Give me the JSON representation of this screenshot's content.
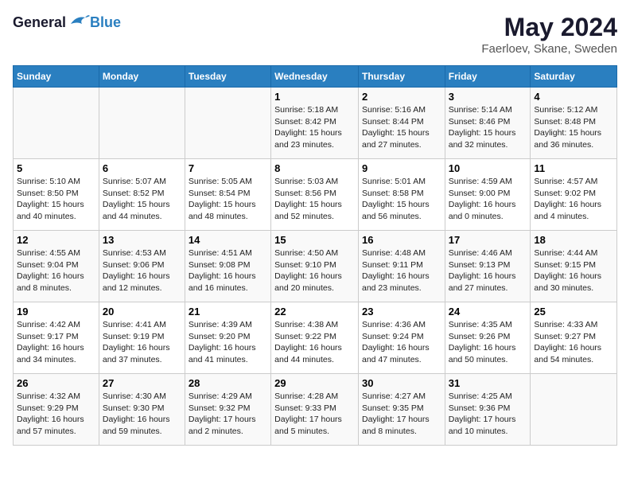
{
  "header": {
    "logo_text_general": "General",
    "logo_text_blue": "Blue",
    "month_title": "May 2024",
    "location": "Faerloev, Skane, Sweden"
  },
  "days_of_week": [
    "Sunday",
    "Monday",
    "Tuesday",
    "Wednesday",
    "Thursday",
    "Friday",
    "Saturday"
  ],
  "weeks": [
    {
      "cells": [
        {
          "day": "",
          "info": ""
        },
        {
          "day": "",
          "info": ""
        },
        {
          "day": "",
          "info": ""
        },
        {
          "day": "1",
          "info": "Sunrise: 5:18 AM\nSunset: 8:42 PM\nDaylight: 15 hours\nand 23 minutes."
        },
        {
          "day": "2",
          "info": "Sunrise: 5:16 AM\nSunset: 8:44 PM\nDaylight: 15 hours\nand 27 minutes."
        },
        {
          "day": "3",
          "info": "Sunrise: 5:14 AM\nSunset: 8:46 PM\nDaylight: 15 hours\nand 32 minutes."
        },
        {
          "day": "4",
          "info": "Sunrise: 5:12 AM\nSunset: 8:48 PM\nDaylight: 15 hours\nand 36 minutes."
        }
      ]
    },
    {
      "cells": [
        {
          "day": "5",
          "info": "Sunrise: 5:10 AM\nSunset: 8:50 PM\nDaylight: 15 hours\nand 40 minutes."
        },
        {
          "day": "6",
          "info": "Sunrise: 5:07 AM\nSunset: 8:52 PM\nDaylight: 15 hours\nand 44 minutes."
        },
        {
          "day": "7",
          "info": "Sunrise: 5:05 AM\nSunset: 8:54 PM\nDaylight: 15 hours\nand 48 minutes."
        },
        {
          "day": "8",
          "info": "Sunrise: 5:03 AM\nSunset: 8:56 PM\nDaylight: 15 hours\nand 52 minutes."
        },
        {
          "day": "9",
          "info": "Sunrise: 5:01 AM\nSunset: 8:58 PM\nDaylight: 15 hours\nand 56 minutes."
        },
        {
          "day": "10",
          "info": "Sunrise: 4:59 AM\nSunset: 9:00 PM\nDaylight: 16 hours\nand 0 minutes."
        },
        {
          "day": "11",
          "info": "Sunrise: 4:57 AM\nSunset: 9:02 PM\nDaylight: 16 hours\nand 4 minutes."
        }
      ]
    },
    {
      "cells": [
        {
          "day": "12",
          "info": "Sunrise: 4:55 AM\nSunset: 9:04 PM\nDaylight: 16 hours\nand 8 minutes."
        },
        {
          "day": "13",
          "info": "Sunrise: 4:53 AM\nSunset: 9:06 PM\nDaylight: 16 hours\nand 12 minutes."
        },
        {
          "day": "14",
          "info": "Sunrise: 4:51 AM\nSunset: 9:08 PM\nDaylight: 16 hours\nand 16 minutes."
        },
        {
          "day": "15",
          "info": "Sunrise: 4:50 AM\nSunset: 9:10 PM\nDaylight: 16 hours\nand 20 minutes."
        },
        {
          "day": "16",
          "info": "Sunrise: 4:48 AM\nSunset: 9:11 PM\nDaylight: 16 hours\nand 23 minutes."
        },
        {
          "day": "17",
          "info": "Sunrise: 4:46 AM\nSunset: 9:13 PM\nDaylight: 16 hours\nand 27 minutes."
        },
        {
          "day": "18",
          "info": "Sunrise: 4:44 AM\nSunset: 9:15 PM\nDaylight: 16 hours\nand 30 minutes."
        }
      ]
    },
    {
      "cells": [
        {
          "day": "19",
          "info": "Sunrise: 4:42 AM\nSunset: 9:17 PM\nDaylight: 16 hours\nand 34 minutes."
        },
        {
          "day": "20",
          "info": "Sunrise: 4:41 AM\nSunset: 9:19 PM\nDaylight: 16 hours\nand 37 minutes."
        },
        {
          "day": "21",
          "info": "Sunrise: 4:39 AM\nSunset: 9:20 PM\nDaylight: 16 hours\nand 41 minutes."
        },
        {
          "day": "22",
          "info": "Sunrise: 4:38 AM\nSunset: 9:22 PM\nDaylight: 16 hours\nand 44 minutes."
        },
        {
          "day": "23",
          "info": "Sunrise: 4:36 AM\nSunset: 9:24 PM\nDaylight: 16 hours\nand 47 minutes."
        },
        {
          "day": "24",
          "info": "Sunrise: 4:35 AM\nSunset: 9:26 PM\nDaylight: 16 hours\nand 50 minutes."
        },
        {
          "day": "25",
          "info": "Sunrise: 4:33 AM\nSunset: 9:27 PM\nDaylight: 16 hours\nand 54 minutes."
        }
      ]
    },
    {
      "cells": [
        {
          "day": "26",
          "info": "Sunrise: 4:32 AM\nSunset: 9:29 PM\nDaylight: 16 hours\nand 57 minutes."
        },
        {
          "day": "27",
          "info": "Sunrise: 4:30 AM\nSunset: 9:30 PM\nDaylight: 16 hours\nand 59 minutes."
        },
        {
          "day": "28",
          "info": "Sunrise: 4:29 AM\nSunset: 9:32 PM\nDaylight: 17 hours\nand 2 minutes."
        },
        {
          "day": "29",
          "info": "Sunrise: 4:28 AM\nSunset: 9:33 PM\nDaylight: 17 hours\nand 5 minutes."
        },
        {
          "day": "30",
          "info": "Sunrise: 4:27 AM\nSunset: 9:35 PM\nDaylight: 17 hours\nand 8 minutes."
        },
        {
          "day": "31",
          "info": "Sunrise: 4:25 AM\nSunset: 9:36 PM\nDaylight: 17 hours\nand 10 minutes."
        },
        {
          "day": "",
          "info": ""
        }
      ]
    }
  ]
}
